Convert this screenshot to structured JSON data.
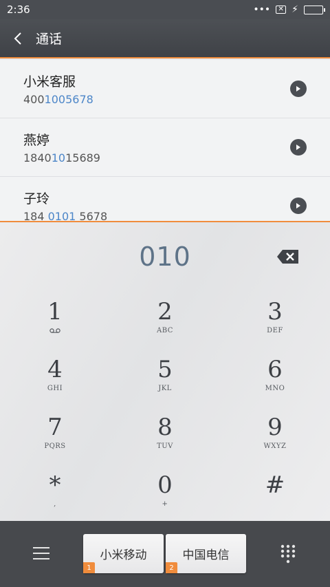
{
  "status": {
    "time": "2:36"
  },
  "header": {
    "title": "通话"
  },
  "contacts": [
    {
      "name": "小米客服",
      "num_pre": "400",
      "num_hl": "1005678",
      "num_post": ""
    },
    {
      "name": "燕婷",
      "num_pre": "1840",
      "num_hl": "10",
      "num_post": "15689"
    },
    {
      "name": "子玲",
      "num_pre": "184 ",
      "num_hl": "0101",
      "num_post": " 5678"
    }
  ],
  "dialer": {
    "input": "010",
    "keys": [
      {
        "num": "1",
        "sub": ""
      },
      {
        "num": "2",
        "sub": "ABC"
      },
      {
        "num": "3",
        "sub": "DEF"
      },
      {
        "num": "4",
        "sub": "GHI"
      },
      {
        "num": "5",
        "sub": "JKL"
      },
      {
        "num": "6",
        "sub": "MNO"
      },
      {
        "num": "7",
        "sub": "PQRS"
      },
      {
        "num": "8",
        "sub": "TUV"
      },
      {
        "num": "9",
        "sub": "WXYZ"
      },
      {
        "num": "*",
        "sub": ","
      },
      {
        "num": "0",
        "sub": "+"
      },
      {
        "num": "#",
        "sub": ""
      }
    ]
  },
  "bottom": {
    "sim1": {
      "label": "小米移动",
      "badge": "1"
    },
    "sim2": {
      "label": "中国电信",
      "badge": "2"
    }
  },
  "colors": {
    "accent": "#f08c3c",
    "highlight": "#4d86c8",
    "bar": "#47494d"
  }
}
